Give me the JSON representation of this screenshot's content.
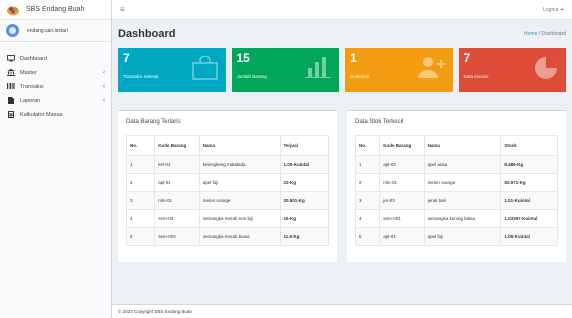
{
  "app": {
    "title": "SBS Endang Buah"
  },
  "user": {
    "name": "endang.sari.lestari"
  },
  "topbar": {
    "menu_icon": "hamburger-icon",
    "logout": "Logout ➜"
  },
  "sidebar": {
    "items": [
      {
        "label": "Dashboard",
        "icon": "monitor-icon",
        "chevron": ""
      },
      {
        "label": "Master",
        "icon": "bank-icon",
        "chevron": "‹"
      },
      {
        "label": "Transaksi",
        "icon": "barcode-icon",
        "chevron": "‹"
      },
      {
        "label": "Laporan",
        "icon": "file-icon",
        "chevron": "‹"
      },
      {
        "label": "Kalkulator Massa",
        "icon": "calculator-icon",
        "chevron": ""
      }
    ]
  },
  "page": {
    "title": "Dashboard",
    "breadcrumb_home": "Home",
    "breadcrumb_sep": " / ",
    "breadcrumb_current": "Dashboard"
  },
  "tiles": [
    {
      "value": "7",
      "label": "Transaksi Selesai",
      "color": "#00a7c0",
      "icon": "shopping-bag-icon"
    },
    {
      "value": "15",
      "label": "Jumlah Barang",
      "color": "#00a65a",
      "icon": "bar-chart-icon"
    },
    {
      "value": "1",
      "label": "Customer",
      "color": "#f39c12",
      "icon": "user-plus-icon"
    },
    {
      "value": "7",
      "label": "Data Invoice",
      "color": "#dd4b39",
      "icon": "pie-chart-icon"
    }
  ],
  "panel_left": {
    "title": "Data Barang Terlaris",
    "headers": [
      "No.",
      "Kode Barang",
      "Nama",
      "Terjual"
    ],
    "rows": [
      [
        "1",
        "kel-01",
        "kelengkeng matalada",
        "1.00-Kuintal"
      ],
      [
        "2",
        "apl-01",
        "apel fuji",
        "22-Kg"
      ],
      [
        "3",
        "mln-01",
        "melon orange",
        "20.501-Kg"
      ],
      [
        "4",
        "sem-03",
        "semangka merah non biji",
        "16-Kg"
      ],
      [
        "5",
        "sem-002",
        "semangka merah biasa",
        "11.5-Kg"
      ]
    ]
  },
  "panel_right": {
    "title": "Data Stok Terkecil",
    "headers": [
      "No.",
      "Kode Barang",
      "Nama",
      "Stock"
    ],
    "rows": [
      [
        "1",
        "apl-03",
        "apel asaa",
        "8.486-Kg"
      ],
      [
        "2",
        "mln-01",
        "melon orange",
        "83.971-Kg"
      ],
      [
        "3",
        "jer-03",
        "jeruk bali",
        "1.01-Kuintal"
      ],
      [
        "4",
        "sem-001",
        "semangka kuning biasa",
        "1.03397-Kuintal"
      ],
      [
        "5",
        "apl-01",
        "apel fuji",
        "1.09-Kuintal"
      ]
    ]
  },
  "footer": {
    "text": "© 2023 Copyright SBS Endang Buah"
  }
}
